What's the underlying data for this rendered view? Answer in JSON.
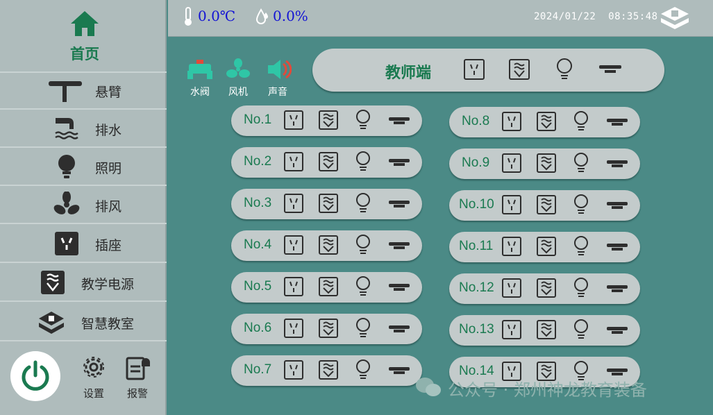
{
  "sidebar": {
    "home_label": "首页",
    "items": [
      {
        "label": "悬臂",
        "icon": "boom-arm-icon"
      },
      {
        "label": "排水",
        "icon": "drain-icon"
      },
      {
        "label": "照明",
        "icon": "bulb-icon"
      },
      {
        "label": "排风",
        "icon": "fan-icon"
      },
      {
        "label": "插座",
        "icon": "socket-icon"
      },
      {
        "label": "教学电源",
        "icon": "teaching-power-icon"
      },
      {
        "label": "智慧教室",
        "icon": "smart-classroom-icon"
      }
    ],
    "settings_label": "设置",
    "alarm_label": "报警"
  },
  "header": {
    "temperature": "0.0℃",
    "humidity": "0.0%",
    "datetime": "2024/01/22  08:35:48"
  },
  "quick": {
    "valve_label": "水阀",
    "fan_label": "风机",
    "sound_label": "声音"
  },
  "teacher": {
    "label": "教师端"
  },
  "stations": [
    {
      "label": "No.1"
    },
    {
      "label": "No.2"
    },
    {
      "label": "No.3"
    },
    {
      "label": "No.4"
    },
    {
      "label": "No.5"
    },
    {
      "label": "No.6"
    },
    {
      "label": "No.7"
    },
    {
      "label": "No.8"
    },
    {
      "label": "No.9"
    },
    {
      "label": "No.10"
    },
    {
      "label": "No.11"
    },
    {
      "label": "No.12"
    },
    {
      "label": "No.13"
    },
    {
      "label": "No.14"
    }
  ],
  "watermark": "公众号 · 郑州神龙教育装备",
  "colors": {
    "accent_green": "#1a7a50",
    "background_teal": "#4b8a86",
    "panel_gray": "#afbcbc",
    "readout_blue": "#1414d4",
    "valve_teal": "#2fc6a6",
    "sound_red": "#e24a3a"
  }
}
